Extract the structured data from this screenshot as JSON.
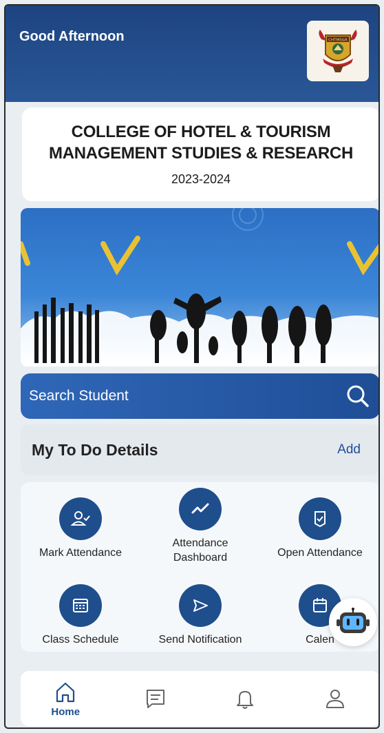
{
  "header": {
    "greeting": "Good Afternoon",
    "logo_text": "CHTMS&R"
  },
  "college": {
    "name_line1": "COLLEGE OF HOTEL & TOURISM",
    "name_line2": "MANAGEMENT STUDIES & RESEARCH",
    "year": "2023-2024"
  },
  "search": {
    "placeholder": "Search Student"
  },
  "todo": {
    "title": "My To Do Details",
    "add_label": "Add"
  },
  "actions": [
    {
      "label": "Mark Attendance",
      "icon": "user-check-icon"
    },
    {
      "label": "Attendance Dashboard",
      "label_line1": "Attendance",
      "label_line2": "Dashboard",
      "icon": "trend-icon"
    },
    {
      "label": "Open Attendance",
      "icon": "shield-check-icon"
    },
    {
      "label": "Class Schedule",
      "icon": "grid-calendar-icon"
    },
    {
      "label": "Send Notification",
      "icon": "send-icon"
    },
    {
      "label": "Calen",
      "icon": "calendar-icon"
    }
  ],
  "bottom_nav": [
    {
      "label": "Home",
      "icon": "home-icon",
      "active": true
    },
    {
      "label": "",
      "icon": "message-icon",
      "active": false
    },
    {
      "label": "",
      "icon": "bell-icon",
      "active": false
    },
    {
      "label": "",
      "icon": "profile-icon",
      "active": false
    }
  ],
  "colors": {
    "primary": "#1f4e8c",
    "header": "#1d4480",
    "background": "#e9eef3"
  }
}
